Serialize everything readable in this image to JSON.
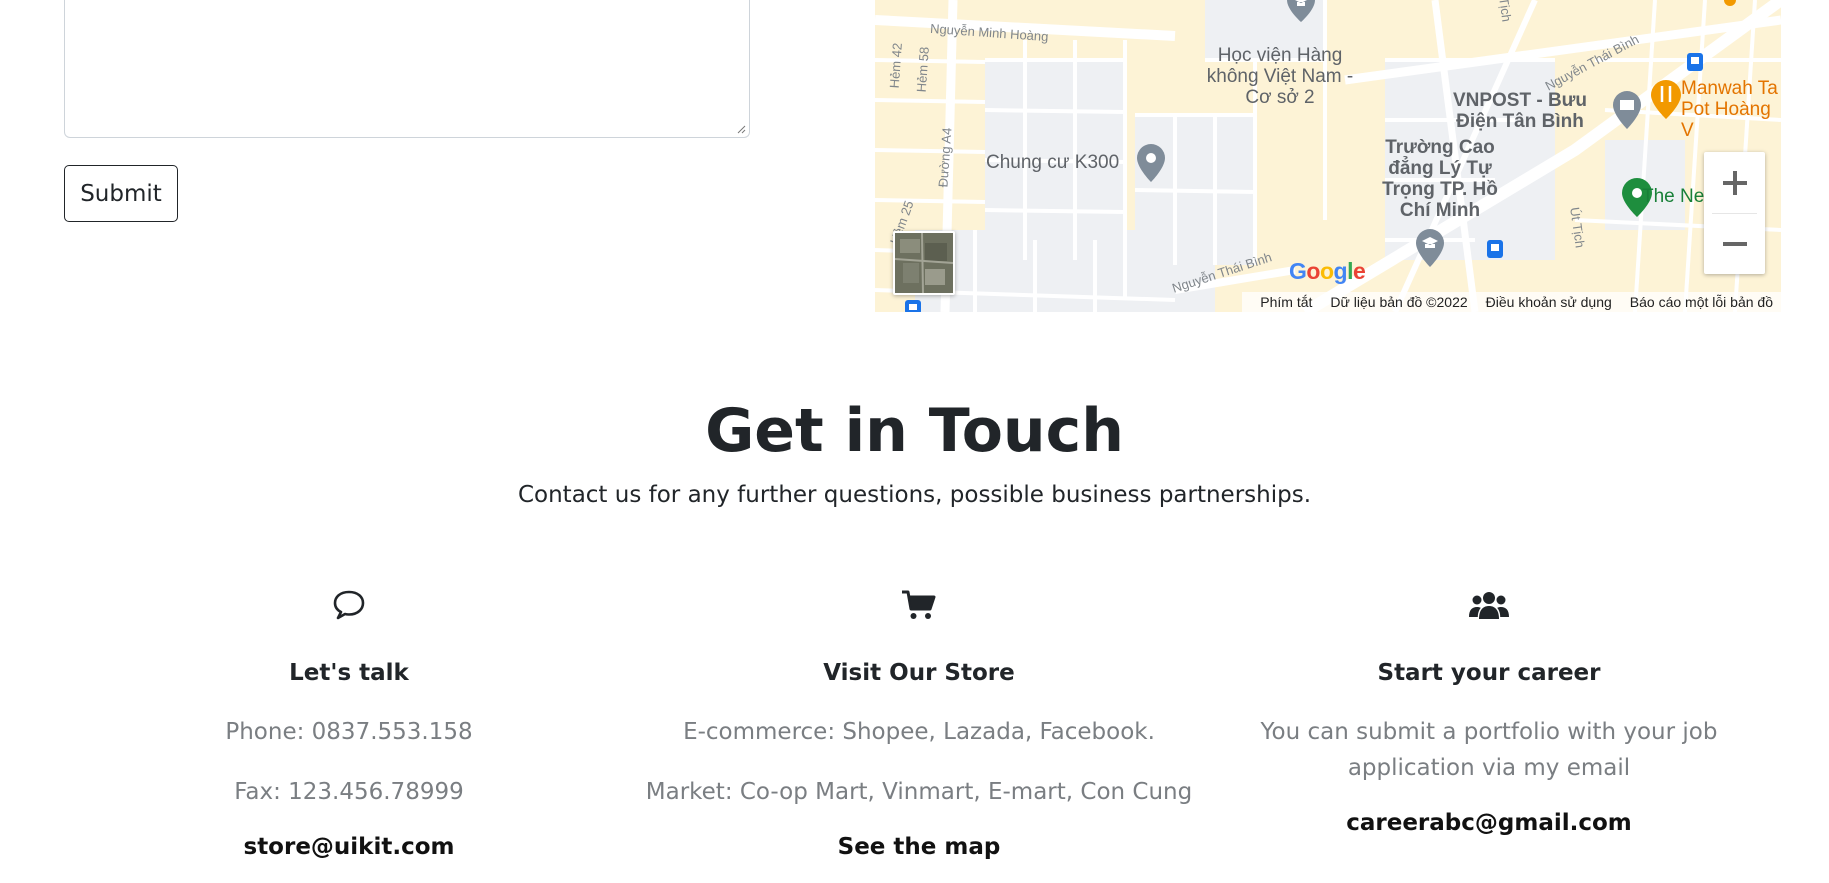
{
  "form": {
    "submit_label": "Submit"
  },
  "map": {
    "labels": {
      "street_nguyen_minh_hoang": "Nguyễn Minh Hoàng",
      "hem_42": "Hẻm 42",
      "hem_58": "Hẻm 58",
      "duong_a4": "Đường A4",
      "hem_25": "Hẻm 25",
      "hoc_vien": "Học viện Hàng không Việt Nam - Cơ sở 2",
      "chung_cu": "Chung cư K300",
      "vnpost": "VNPOST - Bưu Điện Tân Bình",
      "manwah": "Manwah Ta Pot Hoàng V",
      "truong_cao_dang": "Trường Cao đẳng Lý Tự Trọng TP. Hồ Chí Minh",
      "the_new": "The New",
      "nguyen_thai_binh": "Nguyễn Thái Bình",
      "ut_tich": "Út Tịch",
      "tich": "Tịch"
    },
    "google": [
      "G",
      "o",
      "o",
      "g",
      "l",
      "e"
    ],
    "attribution": {
      "shortcuts": "Phím tắt",
      "data": "Dữ liệu bản đồ ©2022",
      "terms": "Điều khoản sử dụng",
      "report": "Báo cáo một lỗi bản đồ"
    },
    "colors": {
      "land": "#fdf3d6",
      "road": "#ffffff",
      "block": "#eef0f3",
      "poi_gray": "#7f8c99",
      "poi_orange": "#f29900",
      "poi_green": "#1e8e3e",
      "poi_text_orange": "#e37400",
      "poi_text_green": "#188038",
      "transit_blue": "#1a73e8"
    }
  },
  "contact": {
    "title": "Get in Touch",
    "subtitle": "Contact us for any further questions, possible business partnerships.",
    "columns": [
      {
        "icon": "chat-bubble-icon",
        "heading": "Let's talk",
        "lines": [
          "Phone: 0837.553.158",
          "Fax: 123.456.78999"
        ],
        "link": "store@uikit.com"
      },
      {
        "icon": "shopping-cart-icon",
        "heading": "Visit Our Store",
        "lines": [
          "E-commerce: Shopee, Lazada, Facebook.",
          "Market: Co-op Mart, Vinmart, E-mart, Con Cung"
        ],
        "link": "See the map"
      },
      {
        "icon": "users-icon",
        "heading": "Start your career",
        "lines": [
          "You can submit a portfolio with your job application via my email"
        ],
        "link": "careerabc@gmail.com"
      }
    ]
  }
}
